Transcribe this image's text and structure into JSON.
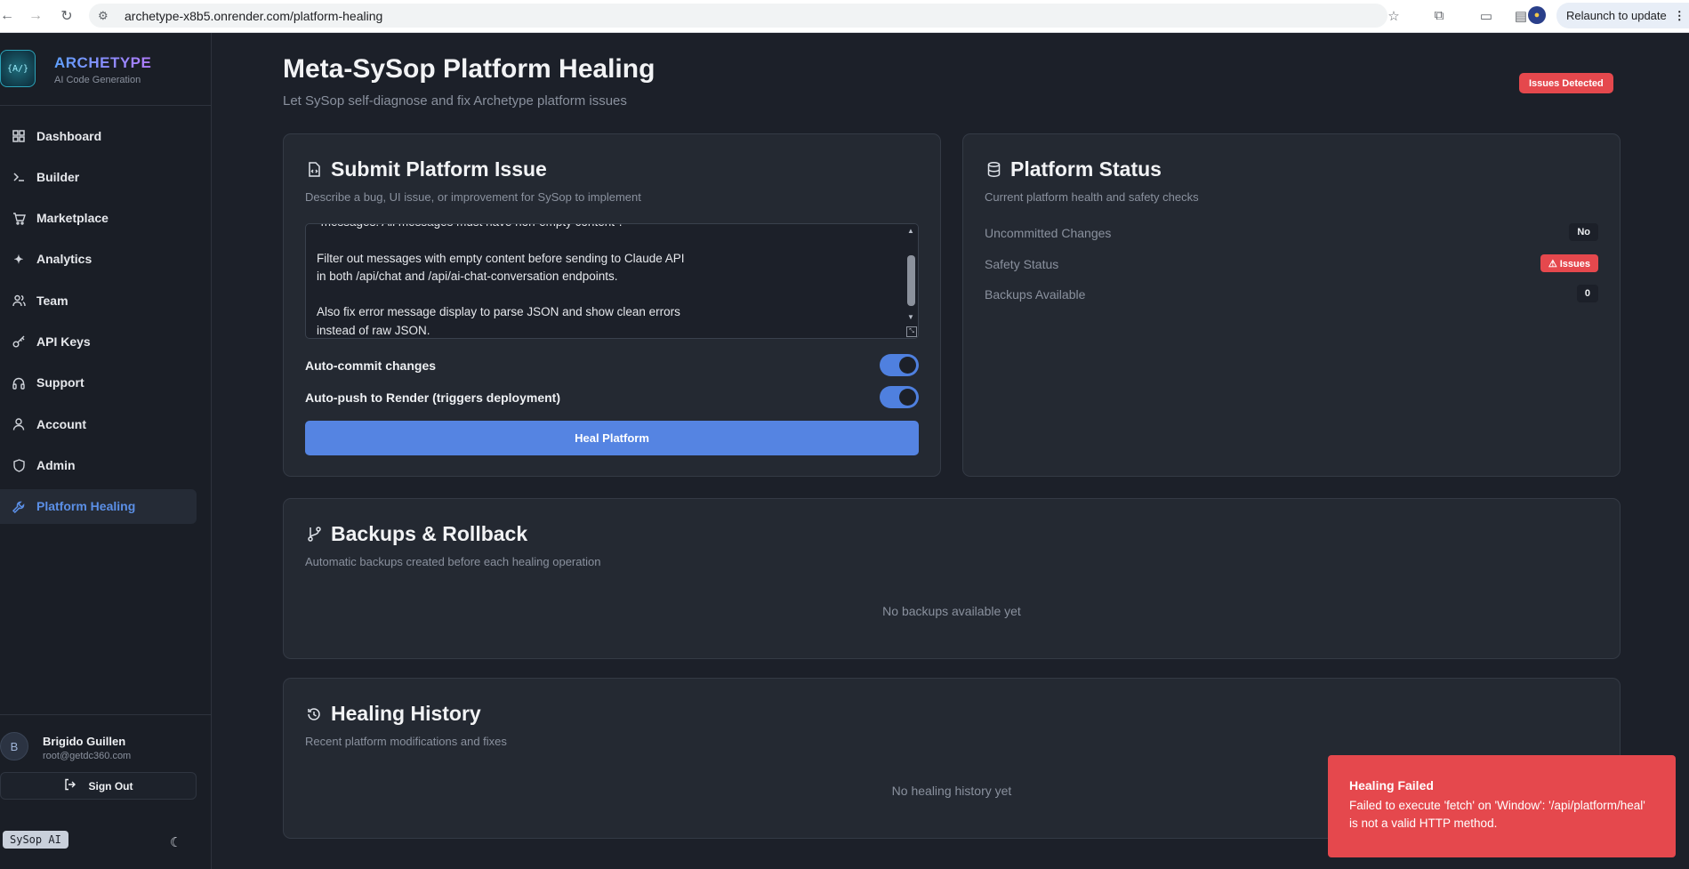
{
  "browser": {
    "url": "archetype-x8b5.onrender.com/platform-healing",
    "relaunch_label": "Relaunch to update",
    "more_glyph": "⋮"
  },
  "brand": {
    "name": "ARCHETYPE",
    "subtitle": "AI Code Generation",
    "logo_text": "{A/}"
  },
  "nav": {
    "items": [
      {
        "label": "Dashboard",
        "icon": "grid-icon"
      },
      {
        "label": "Builder",
        "icon": "terminal-icon"
      },
      {
        "label": "Marketplace",
        "icon": "cart-icon"
      },
      {
        "label": "Analytics",
        "icon": "sparkles-icon"
      },
      {
        "label": "Team",
        "icon": "users-icon"
      },
      {
        "label": "API Keys",
        "icon": "key-icon"
      },
      {
        "label": "Support",
        "icon": "headphones-icon"
      },
      {
        "label": "Account",
        "icon": "user-icon"
      },
      {
        "label": "Admin",
        "icon": "shield-icon"
      },
      {
        "label": "Platform Healing",
        "icon": "wrench-icon",
        "active": true
      }
    ]
  },
  "user": {
    "initial": "B",
    "name": "Brigido Guillen",
    "email": "root@getdc360.com",
    "signout_label": "Sign Out"
  },
  "footer": {
    "badge": "SySop AI"
  },
  "page": {
    "title": "Meta-SySop Platform Healing",
    "subtitle": "Let SySop self-diagnose and fix Archetype platform issues",
    "status_badge": "Issues Detected"
  },
  "submit_card": {
    "title": "Submit Platform Issue",
    "description": "Describe a bug, UI issue, or improvement for SySop to implement",
    "textarea_value": "\"messages: All messages must have non-empty content\".\n\nFilter out messages with empty content before sending to Claude API\nin both /api/chat and /api/ai-chat-conversation endpoints.\n\nAlso fix error message display to parse JSON and show clean errors\ninstead of raw JSON.",
    "toggles": [
      {
        "label": "Auto-commit changes",
        "on": true
      },
      {
        "label": "Auto-push to Render (triggers deployment)",
        "on": true
      }
    ],
    "button_label": "Heal Platform"
  },
  "status_card": {
    "title": "Platform Status",
    "description": "Current platform health and safety checks",
    "rows": [
      {
        "label": "Uncommitted Changes",
        "value": "No",
        "tone": "neutral"
      },
      {
        "label": "Safety Status",
        "value": "⚠ Issues",
        "tone": "danger"
      },
      {
        "label": "Backups Available",
        "value": "0",
        "tone": "neutral"
      }
    ]
  },
  "backups_card": {
    "title": "Backups & Rollback",
    "description": "Automatic backups created before each healing operation",
    "empty": "No backups available yet"
  },
  "history_card": {
    "title": "Healing History",
    "description": "Recent platform modifications and fixes",
    "empty": "No healing history yet"
  },
  "toast": {
    "title": "Healing Failed",
    "message": "Failed to execute 'fetch' on 'Window': '/api/platform/heal' is not a valid HTTP method."
  },
  "colors": {
    "accent": "#5584e2",
    "danger": "#e5484d",
    "background": "#1c2029",
    "card": "#242932"
  }
}
